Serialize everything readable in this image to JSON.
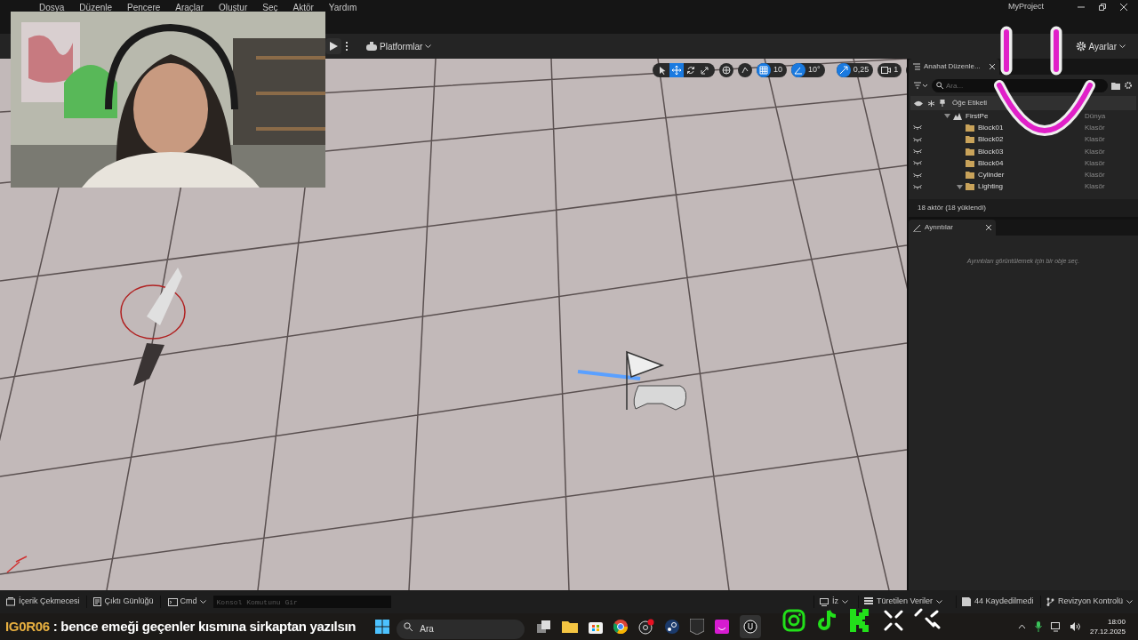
{
  "window": {
    "title": "MyProject"
  },
  "menu": [
    "Dosya",
    "Düzenle",
    "Pencere",
    "Araçlar",
    "Oluştur",
    "Seç",
    "Aktör",
    "Yardım"
  ],
  "toolbar": {
    "platforms": "Platformlar",
    "settings": "Ayarlar"
  },
  "viewport_toolbar": {
    "tools": [
      {
        "kind": "select",
        "selected": false
      },
      {
        "kind": "move",
        "selected": true
      },
      {
        "kind": "rotate",
        "selected": false
      },
      {
        "kind": "scale",
        "selected": false
      }
    ],
    "grid_snap": "10",
    "rotation_snap": "10°",
    "scale_snap": "0,25",
    "camera_speed": "1"
  },
  "outliner": {
    "tab": "Anahat Düzenle...",
    "search": {
      "placeholder": "Ara..."
    },
    "column": "Öğe Etiketi",
    "rows": [
      {
        "label": "FirstPe",
        "type": "Dünya",
        "expanded": true,
        "children": [
          {
            "label": "Block01",
            "type": "Klasör",
            "expanded": false
          },
          {
            "label": "Block02",
            "type": "Klasör",
            "expanded": false
          },
          {
            "label": "Block03",
            "type": "Klasör",
            "expanded": false
          },
          {
            "label": "Block04",
            "type": "Klasör",
            "expanded": false
          },
          {
            "label": "Cylinder",
            "type": "Klasör",
            "expanded": false
          },
          {
            "label": "Lighting",
            "type": "Klasör",
            "expanded": true
          }
        ]
      }
    ],
    "status": "18 aktör (18 yüklendi)"
  },
  "details": {
    "tab": "Ayrıntılar",
    "message": "Ayrıntıları görüntülemek için bir obje seç."
  },
  "bottom_bar": {
    "left": [
      "İçerik Çekmecesi",
      "Çıktı Günlüğü"
    ],
    "cmd": "Cmd",
    "console": {
      "placeholder": "Konsol Komutunu Gir"
    },
    "right": [
      "İz",
      "Türetilen Veriler",
      "44 Kaydedilmedi",
      "Revizyon Kontrolü"
    ]
  },
  "chat": {
    "user": "IG0R06",
    "message": " : bence emeği geçenler kısmına sirkaptan yazılsın"
  },
  "taskbar": {
    "search": {
      "placeholder": "Ara"
    },
    "time": "18:00",
    "date": "27.12.2025"
  }
}
